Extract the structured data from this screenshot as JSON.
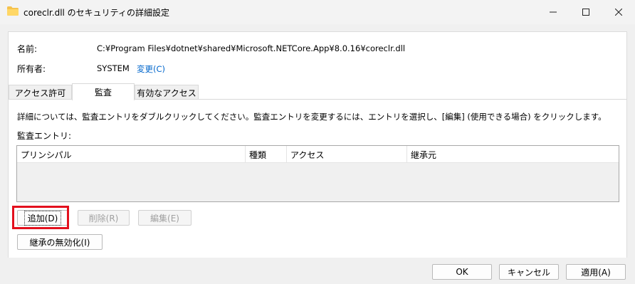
{
  "window": {
    "title": "coreclr.dll のセキュリティの詳細設定",
    "folder_icon": "folder-icon",
    "minimize": "—",
    "maximize": "☐",
    "close": "✕"
  },
  "info": {
    "name_label": "名前:",
    "name_value": "C:¥Program Files¥dotnet¥shared¥Microsoft.NETCore.App¥8.0.16¥coreclr.dll",
    "owner_label": "所有者:",
    "owner_value": "SYSTEM",
    "change_link": "変更(C)"
  },
  "tabs": [
    {
      "label": "アクセス許可"
    },
    {
      "label": "監査"
    },
    {
      "label": "有効なアクセス"
    }
  ],
  "audit": {
    "description": "詳細については、監査エントリをダブルクリックしてください。監査エントリを変更するには、エントリを選択し、[編集] (使用できる場合) をクリックします。",
    "entries_label": "監査エントリ:",
    "columns": [
      "プリンシパル",
      "種類",
      "アクセス",
      "継承元"
    ],
    "add_button": "追加(D)",
    "remove_button": "削除(R)",
    "edit_button": "編集(E)",
    "disable_inheritance_button": "継承の無効化(I)"
  },
  "footer": {
    "ok": "OK",
    "cancel": "キャンセル",
    "apply": "適用(A)"
  },
  "colors": {
    "highlight": "#e3101d",
    "link": "#0066cc"
  }
}
